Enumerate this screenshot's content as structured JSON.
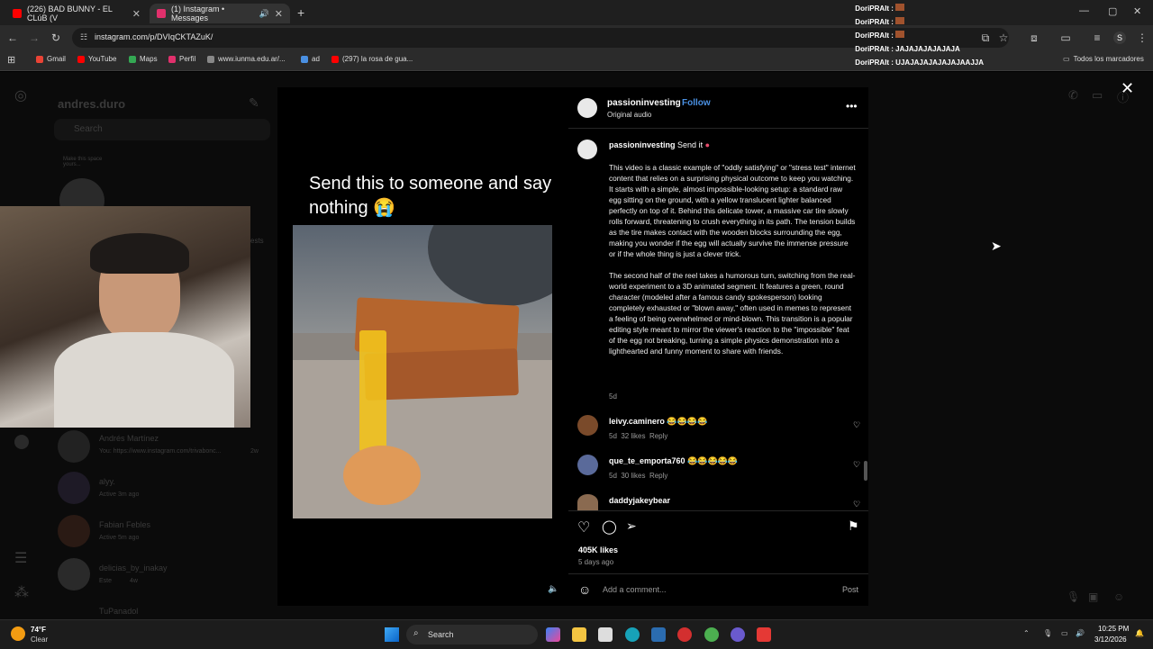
{
  "browser": {
    "tabs": [
      {
        "title": "(226) BAD BUNNY - EL CLúB (V",
        "favicon_color": "#ff0000"
      },
      {
        "title": "(1) Instagram • Messages",
        "favicon_color": "#e1306c"
      }
    ],
    "url": "instagram.com/p/DVIqCKTAZuK/",
    "bookmarks": [
      "Gmail",
      "YouTube",
      "Maps",
      "Perfil",
      "www.iunma.edu.ar/...",
      "ad",
      "(297) la rosa de gua..."
    ],
    "all_bookmarks": "Todos los marcadores"
  },
  "chat_overlay": [
    "DoriPRAIt :",
    "DoriPRAIt :",
    "DoriPRAIt :",
    "DoriPRAIt : JAJAJAJAJAJAJA",
    "DoriPRAIt : UJAJAJAJAJAJAJAAJJA"
  ],
  "messages_bg": {
    "username": "andres.duro",
    "search_placeholder": "Search",
    "note": "Make this space yours...",
    "requests": "ests",
    "conversations": [
      {
        "name": "Andrés Martínez",
        "sub": "You: https://www.instagram.com/trivabonc...",
        "time": "2w"
      },
      {
        "name": "alyy.",
        "sub": "Active 3m ago",
        "time": ""
      },
      {
        "name": "Fabian Febles",
        "sub": "Active 5m ago",
        "time": ""
      },
      {
        "name": "delicias_by_inakay",
        "sub": "Este",
        "time": "4w"
      },
      {
        "name": "TuPanadol",
        "sub": "",
        "time": ""
      }
    ]
  },
  "post": {
    "video_caption": "Send this to someone and say nothing 😭",
    "author": "passioninvesting",
    "follow": "Follow",
    "audio": "Original audio",
    "caption_title": "Send it",
    "caption_p1": "This video is a classic example of \"oddly satisfying\" or \"stress test\" internet content that relies on a surprising physical outcome to keep you watching. It starts with a simple, almost impossible-looking setup: a standard raw egg sitting on the ground, with a yellow translucent lighter balanced perfectly on top of it. Behind this delicate tower, a massive car tire slowly rolls forward, threatening to crush everything in its path. The tension builds as the tire makes contact with the wooden blocks surrounding the egg, making you wonder if the egg will actually survive the immense pressure or if the whole thing is just a clever trick.",
    "caption_p2": "The second half of the reel takes a humorous turn, switching from the real-world experiment to a 3D animated segment. It features a green, round character (modeled after a famous candy spokesperson) looking completely exhausted or \"blown away,\" often used in memes to represent a feeling of being overwhelmed or mind-blown. This transition is a popular editing style meant to mirror the viewer's reaction to the \"impossible\" feat of the egg not breaking, turning a simple physics demonstration into a lighthearted and funny moment to share with friends.",
    "caption_age": "5d",
    "comments": [
      {
        "user": "leivy.caminero",
        "text": "😂😂😂😂",
        "age": "5d",
        "likes": "32 likes",
        "reply": "Reply",
        "avatar_color": "#7a4a2a"
      },
      {
        "user": "que_te_emporta760",
        "text": "😂😂😂😂😂",
        "age": "5d",
        "likes": "30 likes",
        "reply": "Reply",
        "avatar_color": "#5a6a9a"
      },
      {
        "user": "daddyjakeybear",
        "text": "",
        "age": "",
        "likes": "",
        "reply": "",
        "avatar_color": "#8a6a50"
      }
    ],
    "likes": "405K likes",
    "posted": "5 days ago",
    "add_comment_placeholder": "Add a comment...",
    "post_button": "Post"
  },
  "taskbar": {
    "weather_temp": "74°F",
    "weather_desc": "Clear",
    "search": "Search",
    "time": "10:25 PM",
    "date": "3/12/2026"
  }
}
